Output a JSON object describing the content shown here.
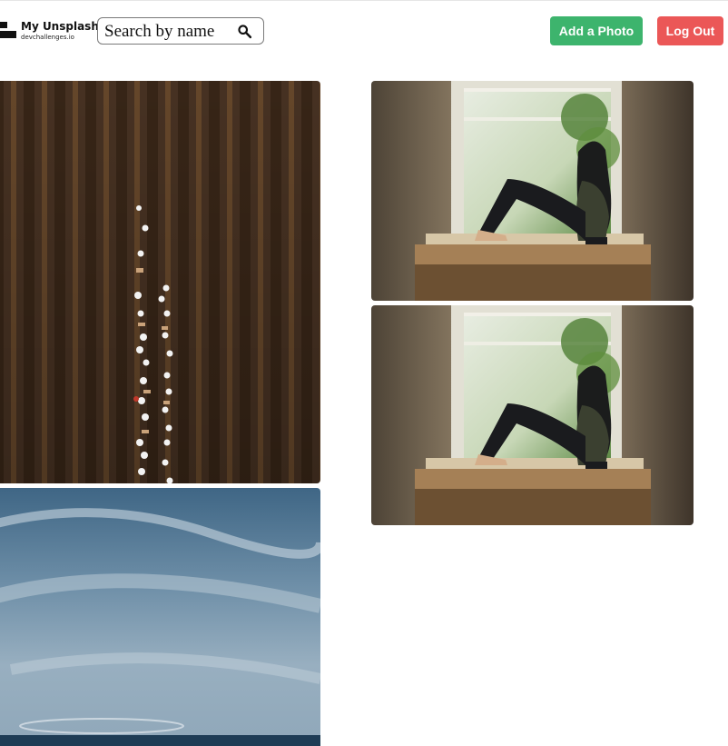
{
  "header": {
    "logo": {
      "title": "My Unsplash",
      "subtitle": "devchallenges.io"
    },
    "search": {
      "placeholder": "Search by name",
      "value": "",
      "icon": "search-icon"
    },
    "add_button_label": "Add a Photo",
    "logout_button_label": "Log Out"
  },
  "colors": {
    "add_button": "#3db46d",
    "logout_button": "#eb5757",
    "search_border": "#7a7a7a"
  },
  "gallery": {
    "photos": [
      {
        "subject": "aerial-field-with-people",
        "column": 1
      },
      {
        "subject": "woman-sitting-by-window",
        "column": 2
      },
      {
        "subject": "woman-sitting-by-window",
        "column": 2
      },
      {
        "subject": "cloudy-blue-sky",
        "column": 1
      }
    ]
  }
}
